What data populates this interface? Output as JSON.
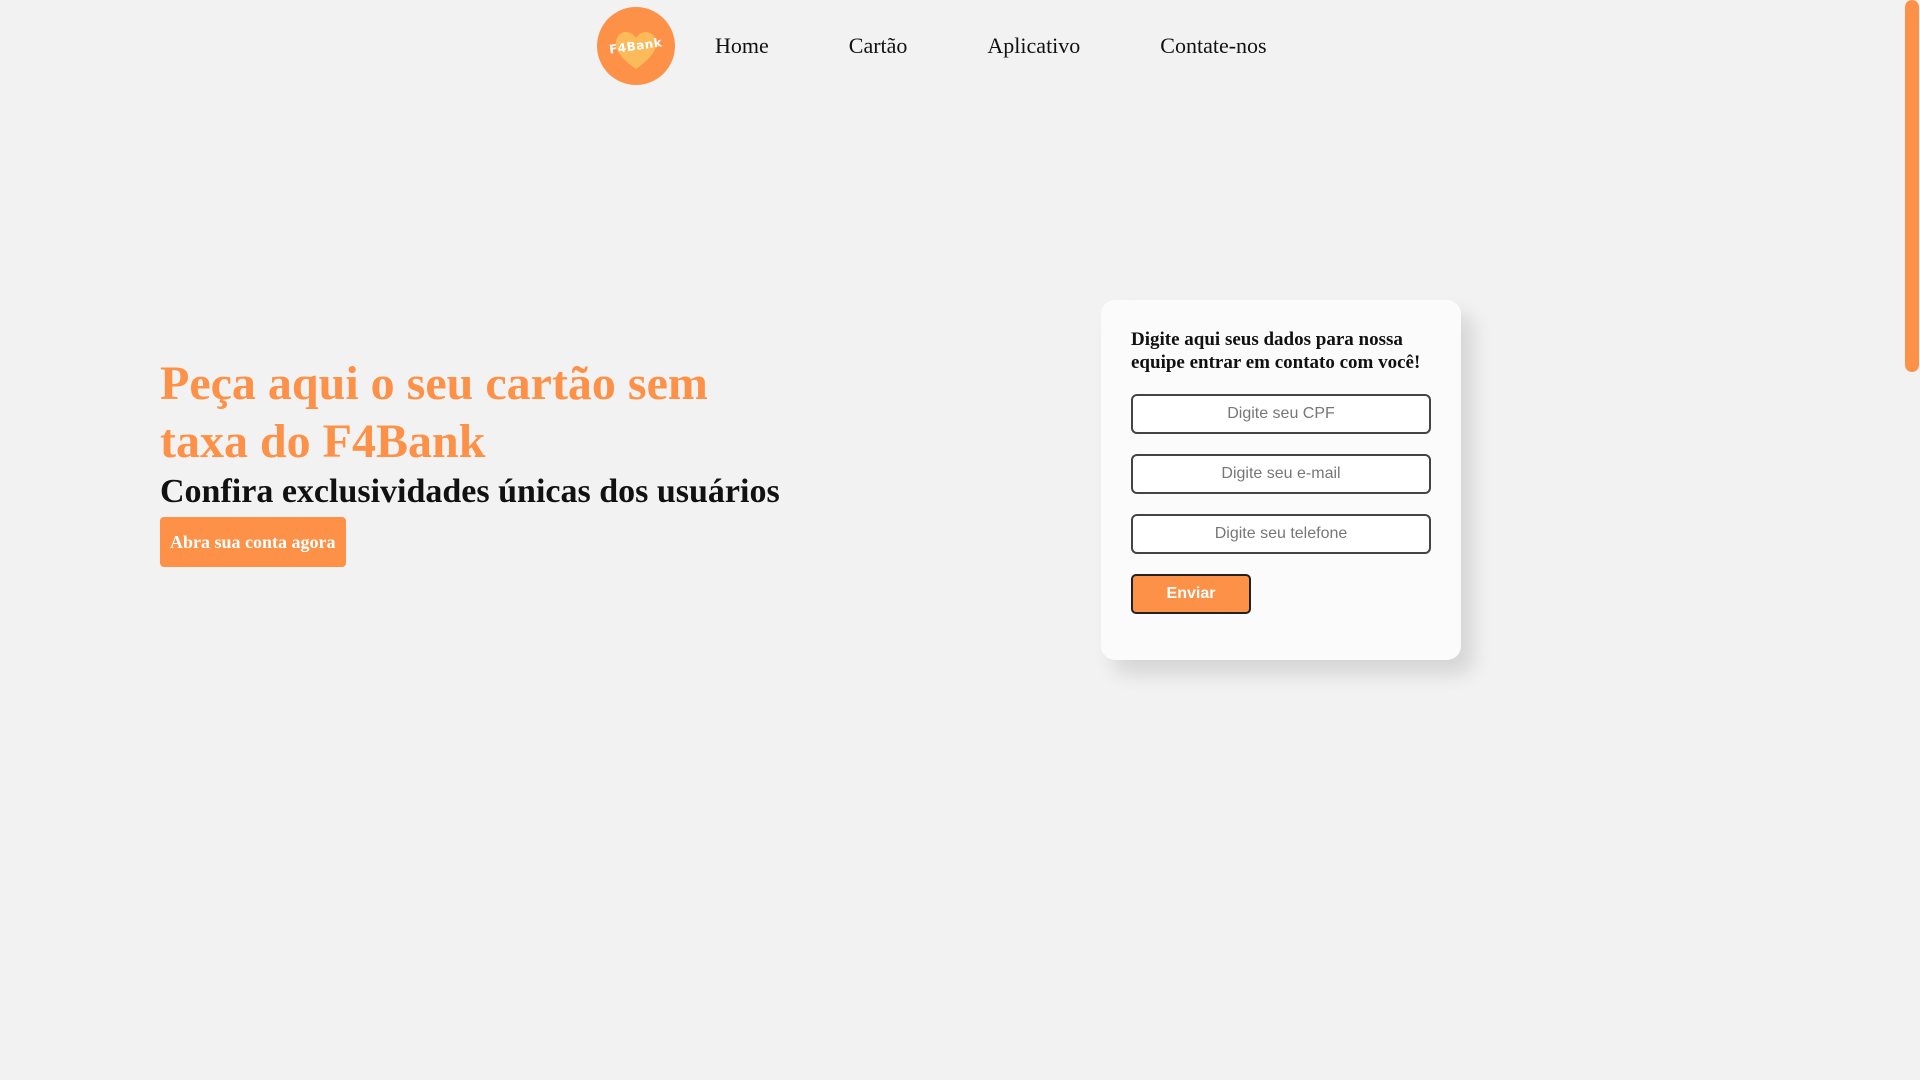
{
  "nav": {
    "logo_text": "F4Bank",
    "links": [
      {
        "label": "Home"
      },
      {
        "label": "Cartão"
      },
      {
        "label": "Aplicativo"
      },
      {
        "label": "Contate-nos"
      }
    ]
  },
  "hero": {
    "title": "Peça aqui o seu cartão sem taxa do F4Bank",
    "subtitle": "Confira exclusividades únicas dos usuários",
    "cta_label": "Abra sua conta agora"
  },
  "form": {
    "title": "Digite aqui seus dados para nossa equipe entrar em contato com você!",
    "cpf_placeholder": "Digite seu CPF",
    "email_placeholder": "Digite seu e-mail",
    "phone_placeholder": "Digite seu telefone",
    "submit_label": "Enviar"
  },
  "colors": {
    "accent": "#fe9148",
    "background": "#f2f2f2",
    "card": "#fbfbfb"
  }
}
